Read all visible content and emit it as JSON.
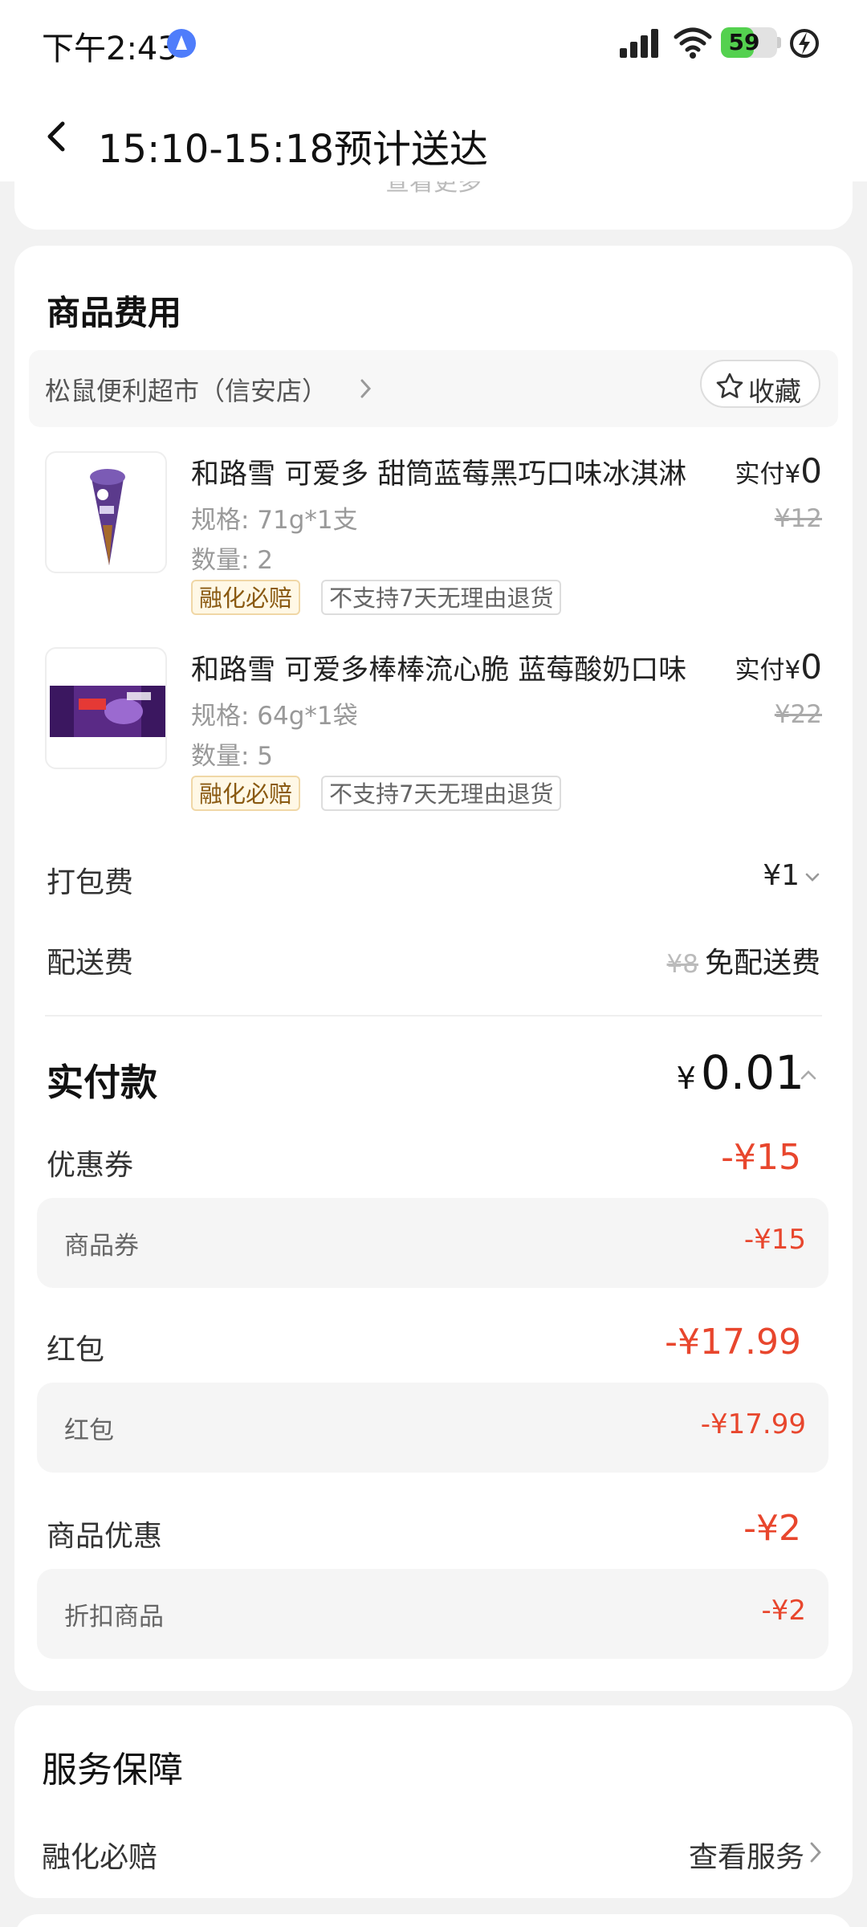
{
  "status_bar": {
    "time": "下午2:43",
    "battery_percent": 59
  },
  "header": {
    "title": "15:10-15:18预计送达"
  },
  "top_card": {
    "text": "查看更多"
  },
  "fees": {
    "title": "商品费用",
    "store": {
      "name": "松鼠便利超市（信安店）",
      "favorite_label": "收藏"
    },
    "items": [
      {
        "name": "和路雪 可爱多 甜筒蓝莓黑巧口味冰淇淋",
        "spec": "规格: 71g*1支",
        "qty": "数量: 2",
        "paid_label": "实付",
        "paid_symbol": "¥",
        "paid_value": "0",
        "original": "¥12",
        "tag_guarantee": "融化必赔",
        "tag_return": "不支持7天无理由退货"
      },
      {
        "name": "和路雪 可爱多棒棒流心脆 蓝莓酸奶口味",
        "spec": "规格: 64g*1袋",
        "qty": "数量: 5",
        "paid_label": "实付",
        "paid_symbol": "¥",
        "paid_value": "0",
        "original": "¥22",
        "tag_guarantee": "融化必赔",
        "tag_return": "不支持7天无理由退货"
      }
    ],
    "packing": {
      "label": "打包费",
      "value": "¥1"
    },
    "delivery": {
      "label": "配送费",
      "original": "¥8",
      "value": "免配送费"
    },
    "total": {
      "label": "实付款",
      "symbol": "¥",
      "value": "0.01"
    },
    "coupon": {
      "label": "优惠券",
      "value": "-¥15",
      "sub_label": "商品券",
      "sub_value": "-¥15"
    },
    "red_packet": {
      "label": "红包",
      "value": "-¥17.99",
      "sub_label": "红包",
      "sub_value": "-¥17.99"
    },
    "product_discount": {
      "label": "商品优惠",
      "value": "-¥2",
      "sub_label": "折扣商品",
      "sub_value": "-¥2"
    }
  },
  "service": {
    "title": "服务保障",
    "item": "融化必赔",
    "link": "查看服务"
  },
  "colors": {
    "discount_red": "#e8462d",
    "battery_green": "#54d14f",
    "tag_gold": "#8a5a12"
  }
}
